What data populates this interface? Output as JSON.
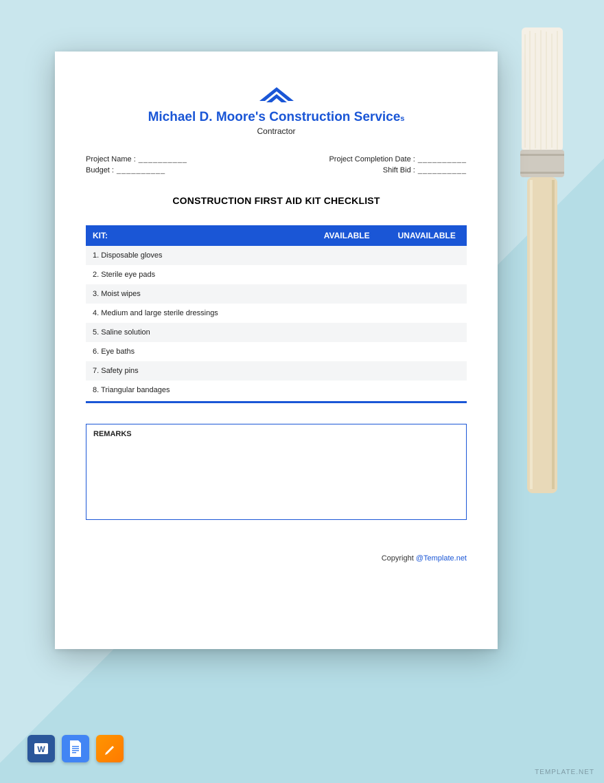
{
  "header": {
    "company_name": "Michael D. Moore's Construction Service",
    "company_suffix": "s",
    "subtitle": "Contractor"
  },
  "fields": {
    "project_name_label": "Project Name :",
    "budget_label": "Budget :",
    "completion_date_label": "Project Completion Date :",
    "shift_bid_label": "Shift Bid :",
    "blank": "__________"
  },
  "checklist": {
    "title": "CONSTRUCTION FIRST AID KIT CHECKLIST",
    "columns": {
      "kit": "KIT:",
      "available": "AVAILABLE",
      "unavailable": "UNAVAILABLE"
    },
    "items": [
      "1. Disposable gloves",
      "2. Sterile eye pads",
      "3. Moist wipes",
      "4. Medium and large sterile dressings",
      "5. Saline solution",
      "6. Eye baths",
      "7. Safety pins",
      "8. Triangular bandages"
    ]
  },
  "remarks": {
    "label": "REMARKS"
  },
  "footer": {
    "copyright_prefix": "Copyright ",
    "copyright_link": "@Template.net"
  },
  "watermark": "TEMPLATE.NET"
}
